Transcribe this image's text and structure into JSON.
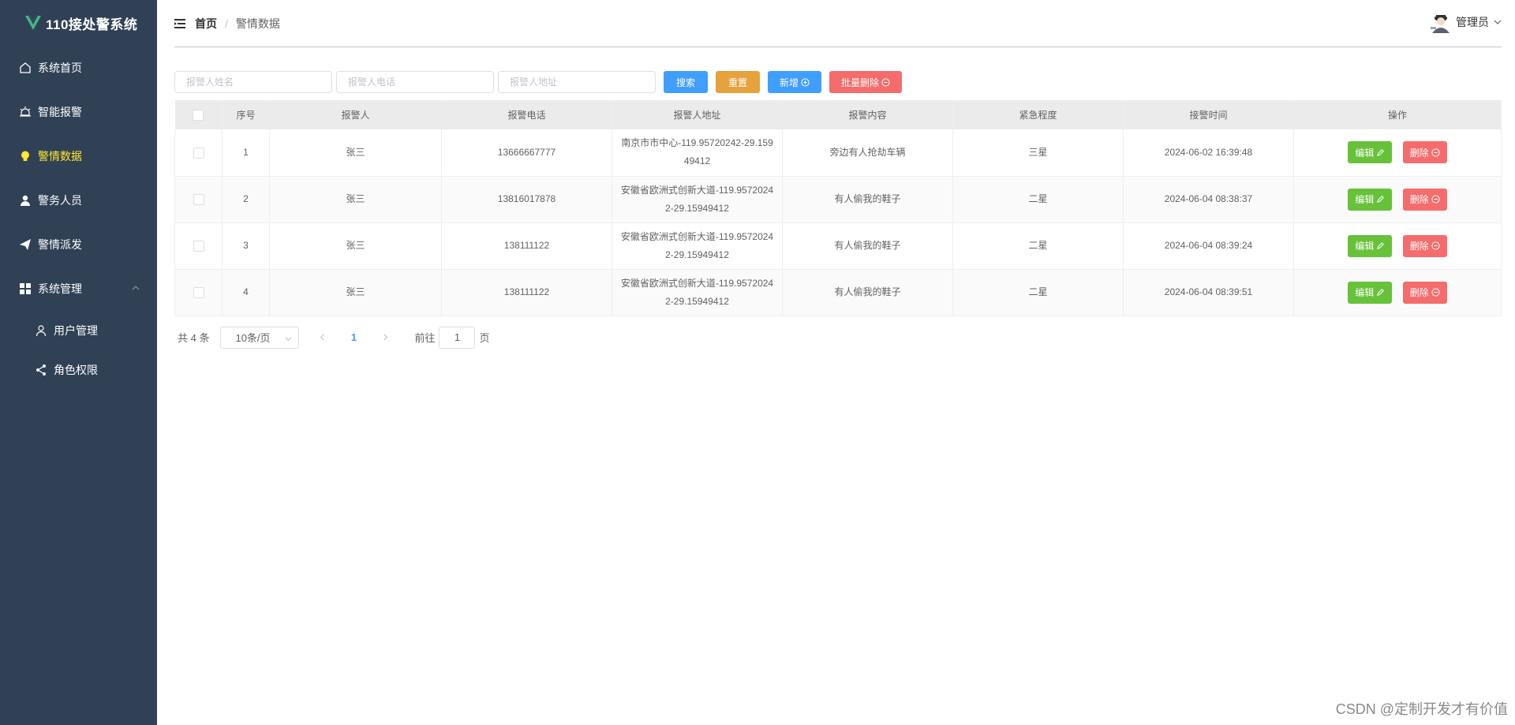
{
  "app": {
    "title": "110接处警系统"
  },
  "sidebar": {
    "items": [
      {
        "label": "系统首页",
        "icon": "home-icon"
      },
      {
        "label": "智能报警",
        "icon": "alarm-icon"
      },
      {
        "label": "警情数据",
        "icon": "bulb-icon",
        "active": true
      },
      {
        "label": "警务人员",
        "icon": "person-icon"
      },
      {
        "label": "警情派发",
        "icon": "send-icon"
      },
      {
        "label": "系统管理",
        "icon": "grid-icon",
        "expanded": true
      }
    ],
    "subitems": [
      {
        "label": "用户管理",
        "icon": "user-icon"
      },
      {
        "label": "角色权限",
        "icon": "share-icon"
      }
    ]
  },
  "header": {
    "breadcrumb_home": "首页",
    "breadcrumb_sep": "/",
    "breadcrumb_current": "警情数据",
    "user_name": "管理员"
  },
  "filters": {
    "name_placeholder": "报警人姓名",
    "phone_placeholder": "报警人电话",
    "address_placeholder": "报警人地址"
  },
  "toolbar": {
    "search_label": "搜索",
    "reset_label": "重置",
    "add_label": "新增",
    "batch_delete_label": "批量删除"
  },
  "table": {
    "columns": [
      "序号",
      "报警人",
      "报警电话",
      "报警人地址",
      "报警内容",
      "紧急程度",
      "接警时间",
      "操作"
    ],
    "rows": [
      {
        "index": "1",
        "name": "张三",
        "phone": "13666667777",
        "address": "南京市市中心-119.95720242-29.15949412",
        "content": "旁边有人抢劫车辆",
        "urgency": "三星",
        "time": "2024-06-02 16:39:48"
      },
      {
        "index": "2",
        "name": "张三",
        "phone": "13816017878",
        "address": "安徽省欧洲式创新大道-119.95720242-29.15949412",
        "content": "有人偷我的鞋子",
        "urgency": "二星",
        "time": "2024-06-04 08:38:37"
      },
      {
        "index": "3",
        "name": "张三",
        "phone": "138111122",
        "address": "安徽省欧洲式创新大道-119.95720242-29.15949412",
        "content": "有人偷我的鞋子",
        "urgency": "二星",
        "time": "2024-06-04 08:39:24"
      },
      {
        "index": "4",
        "name": "张三",
        "phone": "138111122",
        "address": "安徽省欧洲式创新大道-119.95720242-29.15949412",
        "content": "有人偷我的鞋子",
        "urgency": "二星",
        "time": "2024-06-04 08:39:51"
      }
    ],
    "edit_label": "编辑",
    "delete_label": "删除"
  },
  "pagination": {
    "total_text": "共 4 条",
    "page_size": "10条/页",
    "current_page": "1",
    "goto_label": "前往",
    "goto_value": "1",
    "page_suffix": "页"
  },
  "watermark": "CSDN @定制开发才有价值",
  "colors": {
    "sidebar_bg": "#304156",
    "active_menu": "#ffe82d",
    "primary": "#409eff",
    "warning": "#e6a23c",
    "success": "#67c23a",
    "danger": "#f56c6c"
  }
}
